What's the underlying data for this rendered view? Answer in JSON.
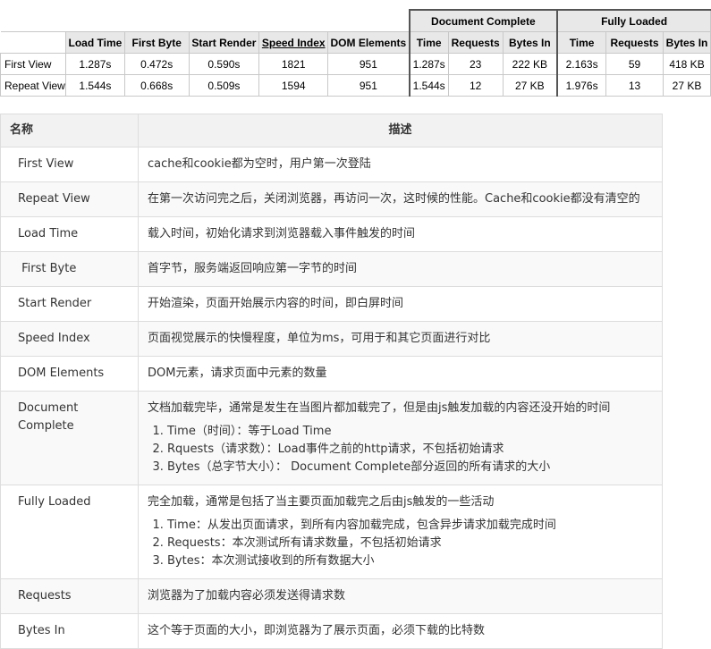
{
  "results": {
    "groups": {
      "document_complete": "Document Complete",
      "fully_loaded": "Fully Loaded"
    },
    "headers": [
      "Load Time",
      "First Byte",
      "Start Render",
      "Speed Index",
      "DOM Elements",
      "Time",
      "Requests",
      "Bytes In",
      "Time",
      "Requests",
      "Bytes In"
    ],
    "rows": [
      {
        "label": "First View",
        "cells": [
          "1.287s",
          "0.472s",
          "0.590s",
          "1821",
          "951",
          "1.287s",
          "23",
          "222 KB",
          "2.163s",
          "59",
          "418 KB"
        ]
      },
      {
        "label": "Repeat View",
        "cells": [
          "1.544s",
          "0.668s",
          "0.509s",
          "1594",
          "951",
          "1.544s",
          "12",
          "27 KB",
          "1.976s",
          "13",
          "27 KB"
        ]
      }
    ]
  },
  "desc": {
    "header_name": "名称",
    "header_desc": "描述",
    "rows": [
      {
        "name": "First View",
        "desc": "cache和cookie都为空时，用户第一次登陆"
      },
      {
        "name": "Repeat View",
        "desc": "在第一次访问完之后，关闭浏览器，再访问一次，这时候的性能。Cache和cookie都没有清空的"
      },
      {
        "name": "Load Time",
        "desc": "载入时间，初始化请求到浏览器载入事件触发的时间"
      },
      {
        "name": " First Byte",
        "desc": "首字节，服务端返回响应第一字节的时间"
      },
      {
        "name": "Start Render",
        "desc": "开始渲染，页面开始展示内容的时间，即白屏时间"
      },
      {
        "name": "Speed Index",
        "desc": "页面视觉展示的快慢程度，单位为ms，可用于和其它页面进行对比"
      },
      {
        "name": "DOM Elements",
        "desc": "DOM元素，请求页面中元素的数量"
      },
      {
        "name": "Document Complete",
        "desc": "文档加载完毕，通常是发生在当图片都加载完了，但是由js触发加载的内容还没开始的时间",
        "list": [
          "Time（时间）：等于Load Time",
          "Rquests（请求数）：Load事件之前的http请求，不包括初始请求",
          "Bytes（总字节大小）： Document Complete部分返回的所有请求的大小"
        ]
      },
      {
        "name": "Fully Loaded",
        "desc": "完全加载，通常是包括了当主要页面加载完之后由js触发的一些活动",
        "list": [
          "Time：从发出页面请求，到所有内容加载完成，包含异步请求加载完成时间",
          "Requests：本次测试所有请求数量，不包括初始请求",
          "Bytes：本次测试接收到的所有数据大小"
        ]
      },
      {
        "name": "Requests",
        "desc": "浏览器为了加载内容必须发送得请求数"
      },
      {
        "name": "Bytes In",
        "desc": "这个等于页面的大小，即浏览器为了展示页面，必须下载的比特数"
      }
    ]
  }
}
